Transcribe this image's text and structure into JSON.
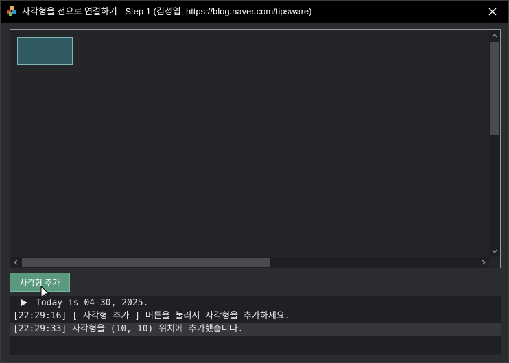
{
  "window": {
    "title": "사각형을 선으로 연결하기 - Step 1 (김성엽, https://blog.naver.com/tipsware)",
    "icon": "app-blocks-icon",
    "close_icon": "close-icon"
  },
  "canvas": {
    "rect_color": "#2f5a62",
    "rect_border_color": "#7fb6b6"
  },
  "toolbar": {
    "add_rect_label": "사각형 추가",
    "accent_color": "#5c9a7f"
  },
  "log": {
    "lines": [
      {
        "text": "Today is 04-30, 2025.",
        "icon": "play-icon"
      },
      {
        "text": "[22:29:16] [ 사각형 추가 ] 버튼을 눌러서 사각형을 추가하세요."
      },
      {
        "text": "[22:29:33] 사각형을 (10, 10) 위치에 추가했습니다."
      }
    ]
  }
}
